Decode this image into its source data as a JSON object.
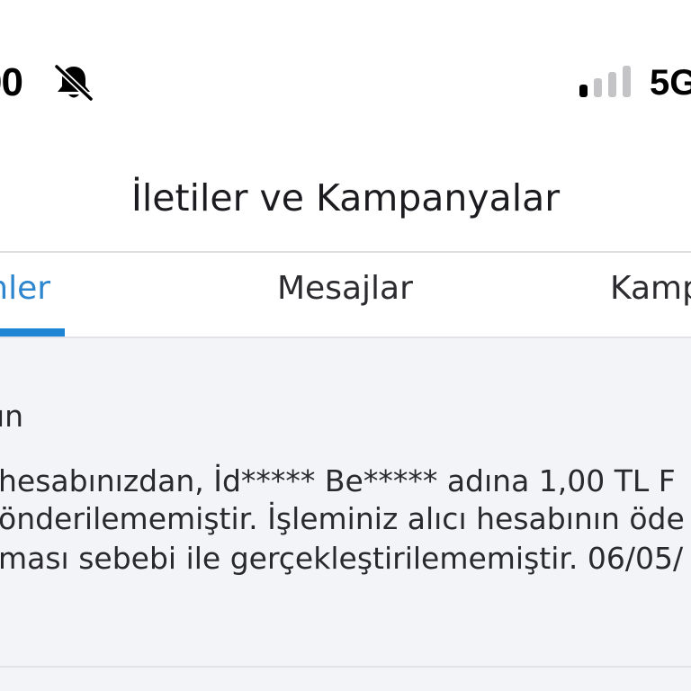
{
  "status_bar": {
    "time": "00",
    "network": "5G",
    "icons": [
      "bell-slash-icon",
      "signal-bars-icon"
    ]
  },
  "header": {
    "title": "İletiler ve Kampanyalar"
  },
  "tabs": [
    {
      "label": "mler",
      "active": true
    },
    {
      "label": "Mesajlar",
      "active": false
    },
    {
      "label": "Kamp",
      "active": false
    }
  ],
  "message": {
    "title": "ın",
    "lines": [
      "hesabınızdan, İd***** Be***** adına 1,00 TL F",
      "önderilememiştir. İşleminiz alıcı hesabının öde",
      "ması sebebi ile gerçekleştirilememiştir. 06/05/"
    ]
  },
  "colors": {
    "accent": "#1e84d4",
    "active_tab_text": "#2e86cf",
    "content_background": "#f3f4f8",
    "signal_active": "#000000",
    "signal_inactive": "#c4c4c6"
  }
}
